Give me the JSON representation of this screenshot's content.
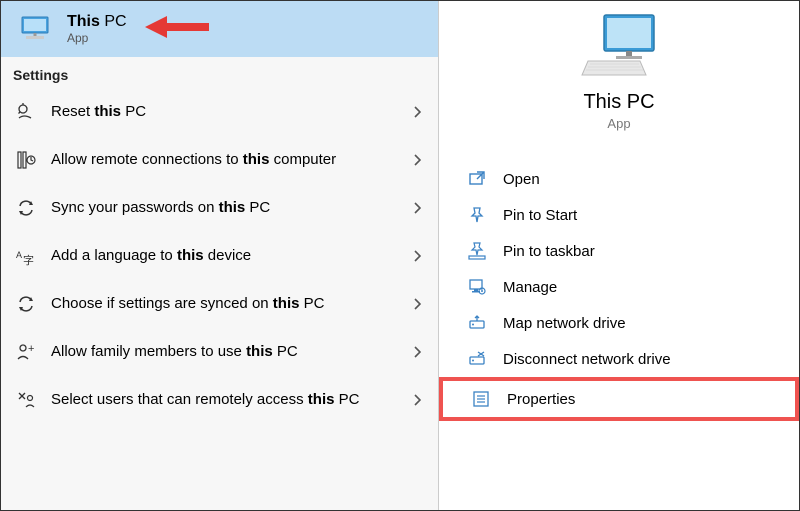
{
  "selected": {
    "title_prefix": "This",
    "title_suffix": " PC",
    "subtitle": "App"
  },
  "settings_header": "Settings",
  "settings": [
    {
      "icon": "reset-icon",
      "parts": [
        [
          "Reset ",
          "n"
        ],
        [
          "this",
          "b"
        ],
        [
          " PC",
          "n"
        ]
      ]
    },
    {
      "icon": "remote-icon",
      "parts": [
        [
          "Allow remote connections to ",
          "n"
        ],
        [
          "this",
          "b"
        ],
        [
          " computer",
          "n"
        ]
      ]
    },
    {
      "icon": "sync-icon",
      "parts": [
        [
          "Sync your passwords on ",
          "n"
        ],
        [
          "this",
          "b"
        ],
        [
          " PC",
          "n"
        ]
      ]
    },
    {
      "icon": "language-icon",
      "parts": [
        [
          "Add a language to ",
          "n"
        ],
        [
          "this",
          "b"
        ],
        [
          " device",
          "n"
        ]
      ]
    },
    {
      "icon": "sync-icon",
      "parts": [
        [
          "Choose if settings are synced on ",
          "n"
        ],
        [
          "this",
          "b"
        ],
        [
          " PC",
          "n"
        ]
      ]
    },
    {
      "icon": "family-icon",
      "parts": [
        [
          "Allow family members to use ",
          "n"
        ],
        [
          "this",
          "b"
        ],
        [
          " PC",
          "n"
        ]
      ]
    },
    {
      "icon": "remote-users-icon",
      "parts": [
        [
          "Select users that can remotely access ",
          "n"
        ],
        [
          "this",
          "b"
        ],
        [
          " PC",
          "n"
        ]
      ]
    }
  ],
  "preview": {
    "title": "This PC",
    "subtitle": "App"
  },
  "actions": [
    {
      "icon": "open-icon",
      "label": "Open",
      "highlight": false
    },
    {
      "icon": "pin-start-icon",
      "label": "Pin to Start",
      "highlight": false
    },
    {
      "icon": "pin-taskbar-icon",
      "label": "Pin to taskbar",
      "highlight": false
    },
    {
      "icon": "manage-icon",
      "label": "Manage",
      "highlight": false
    },
    {
      "icon": "map-drive-icon",
      "label": "Map network drive",
      "highlight": false
    },
    {
      "icon": "disconnect-drive-icon",
      "label": "Disconnect network drive",
      "highlight": false
    },
    {
      "icon": "properties-icon",
      "label": "Properties",
      "highlight": true
    }
  ]
}
